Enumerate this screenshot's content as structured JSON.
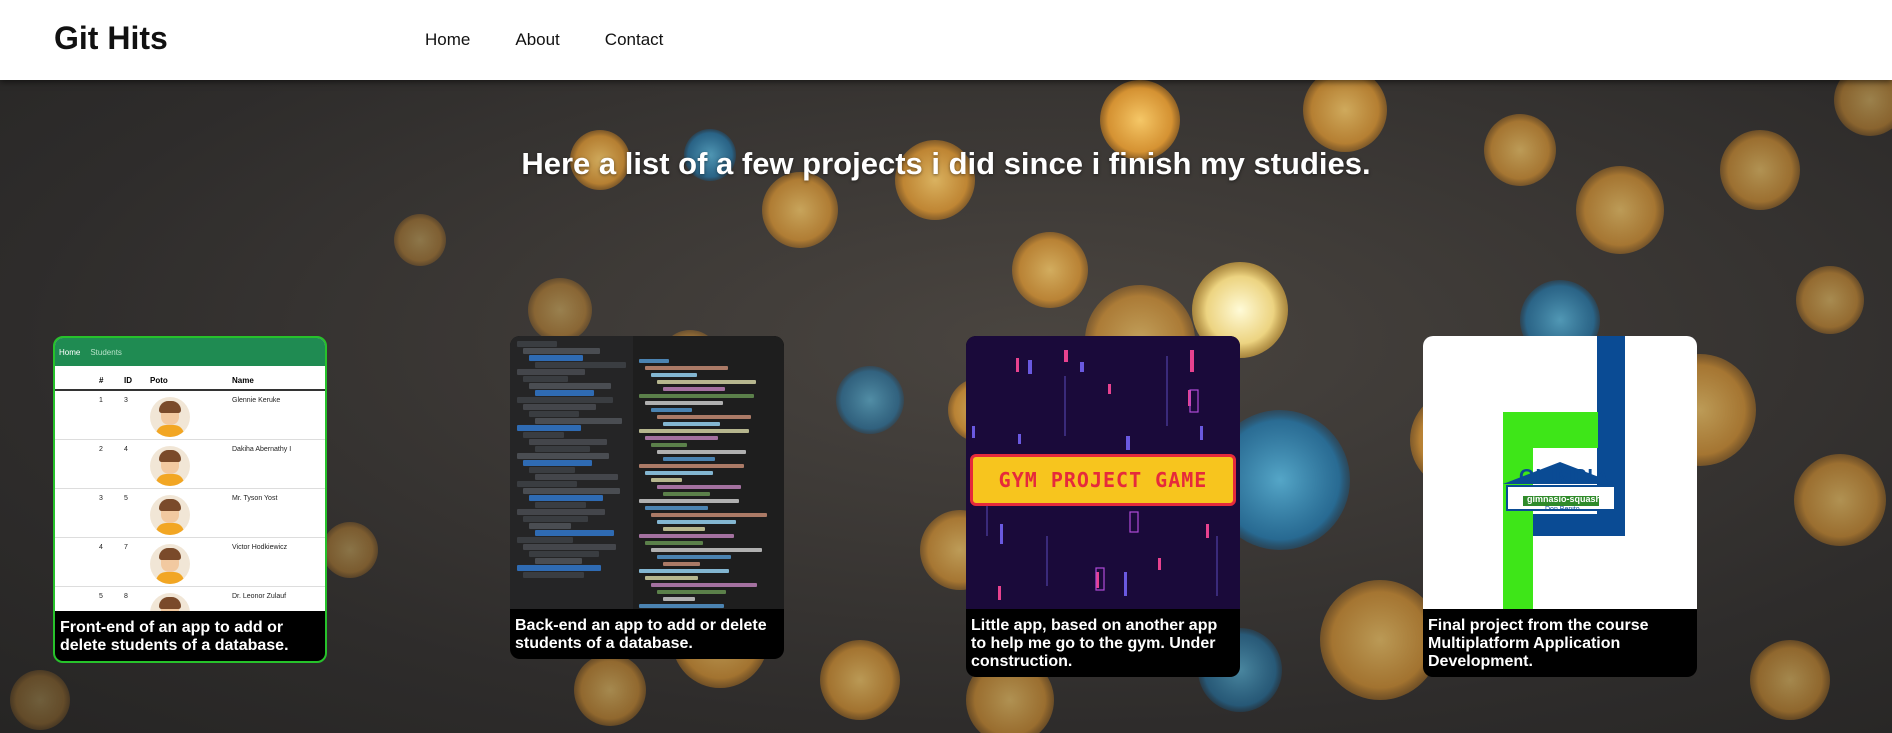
{
  "header": {
    "brand": "Git Hits",
    "nav": [
      {
        "label": "Home"
      },
      {
        "label": "About"
      },
      {
        "label": "Contact"
      }
    ]
  },
  "main": {
    "headline": "Here a list of a few projects i did since i finish my studies."
  },
  "projects": [
    {
      "caption": "Front-end of an app to add or delete students of a database.",
      "thumb": {
        "nav_home": "Home",
        "nav_students": "Students",
        "columns": [
          "#",
          "ID",
          "Poto",
          "Name"
        ],
        "rows": [
          {
            "n": "1",
            "id": "3",
            "name": "Glennie Keruke"
          },
          {
            "n": "2",
            "id": "4",
            "name": "Dakiha Abernathy I"
          },
          {
            "n": "3",
            "id": "5",
            "name": "Mr. Tyson Yost"
          },
          {
            "n": "4",
            "id": "7",
            "name": "Victor Hodkiewicz"
          },
          {
            "n": "5",
            "id": "8",
            "name": "Dr. Leonor Zulauf"
          }
        ]
      }
    },
    {
      "caption": "Back-end an app to add or delete students of a database."
    },
    {
      "caption": "Little app, based on another app to help me go to the gym. Under construction.",
      "thumb": {
        "title": "GYM PROJECT GAME"
      }
    },
    {
      "caption": "Final project from the course Multiplatform Application Development.",
      "thumb": {
        "logo_main": "OLIMPIA",
        "logo_sub": "gimnasio-squash",
        "logo_place": "Don Benito"
      }
    }
  ],
  "colors": {
    "header_bg": "#ffffff",
    "card_highlight": "#27c22b",
    "caption_bg": "#000000"
  }
}
